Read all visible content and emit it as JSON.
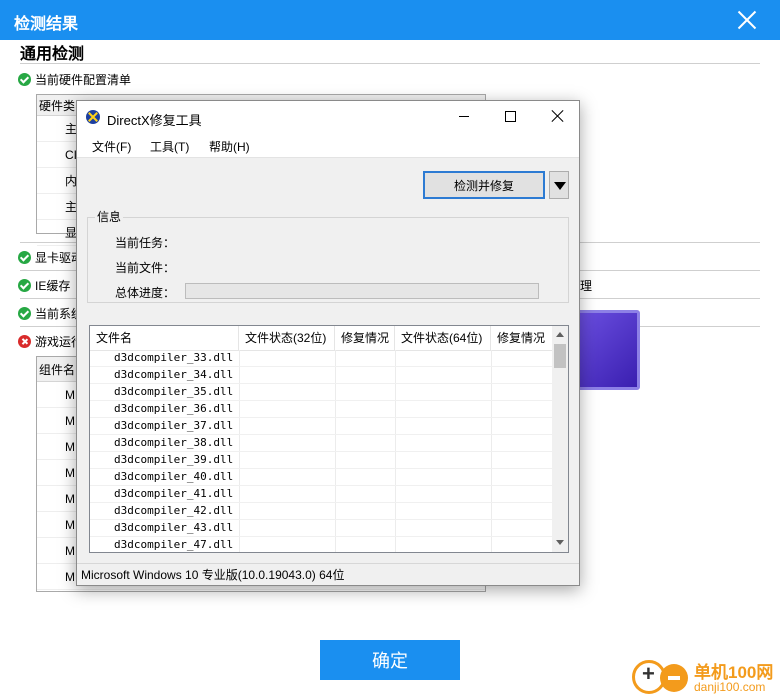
{
  "dialog": {
    "title": "检测结果",
    "section_title": "通用检测",
    "confirm_label": "确定"
  },
  "checks": [
    {
      "label": "当前硬件配置清单",
      "status": "ok"
    },
    {
      "label": "显卡驱动",
      "status": "ok"
    },
    {
      "label": "IE缓存",
      "status": "ok"
    },
    {
      "label": "当前系统",
      "status": "ok"
    },
    {
      "label": "游戏运行",
      "status": "error"
    }
  ],
  "hardware_table": {
    "header": "硬件类",
    "rows": [
      "主",
      "CI",
      "内",
      "主",
      "显"
    ]
  },
  "components_table": {
    "header": "组件名",
    "rows": [
      "M",
      "M",
      "M",
      "M",
      "M",
      "M",
      "M",
      "M"
    ]
  },
  "partial_suffix": "理",
  "dx_window": {
    "title": "DirectX修复工具",
    "menu": [
      "文件(F)",
      "工具(T)",
      "帮助(H)"
    ],
    "detect_button": "检测并修复",
    "info_group": "信息",
    "info_labels": [
      "当前任务：",
      "当前文件：",
      "总体进度："
    ],
    "progress": 0,
    "columns": [
      "文件名",
      "文件状态(32位)",
      "修复情况",
      "文件状态(64位)",
      "修复情况"
    ],
    "files": [
      "d3dcompiler_33.dll",
      "d3dcompiler_34.dll",
      "d3dcompiler_35.dll",
      "d3dcompiler_36.dll",
      "d3dcompiler_37.dll",
      "d3dcompiler_38.dll",
      "d3dcompiler_39.dll",
      "d3dcompiler_40.dll",
      "d3dcompiler_41.dll",
      "d3dcompiler_42.dll",
      "d3dcompiler_43.dll",
      "d3dcompiler_47.dll"
    ],
    "status_bar": "Microsoft Windows 10 专业版(10.0.19043.0) 64位"
  },
  "watermark": {
    "name": "单机100网",
    "domain": "danji100.com"
  },
  "icons": {
    "close": "close-icon",
    "ok": "check-circle-icon",
    "error": "error-circle-icon",
    "app": "directx-icon"
  },
  "colors": {
    "accent": "#1a8ff0",
    "ok": "#27a844",
    "error": "#d92b2b",
    "watermark": "#f39b1c"
  }
}
